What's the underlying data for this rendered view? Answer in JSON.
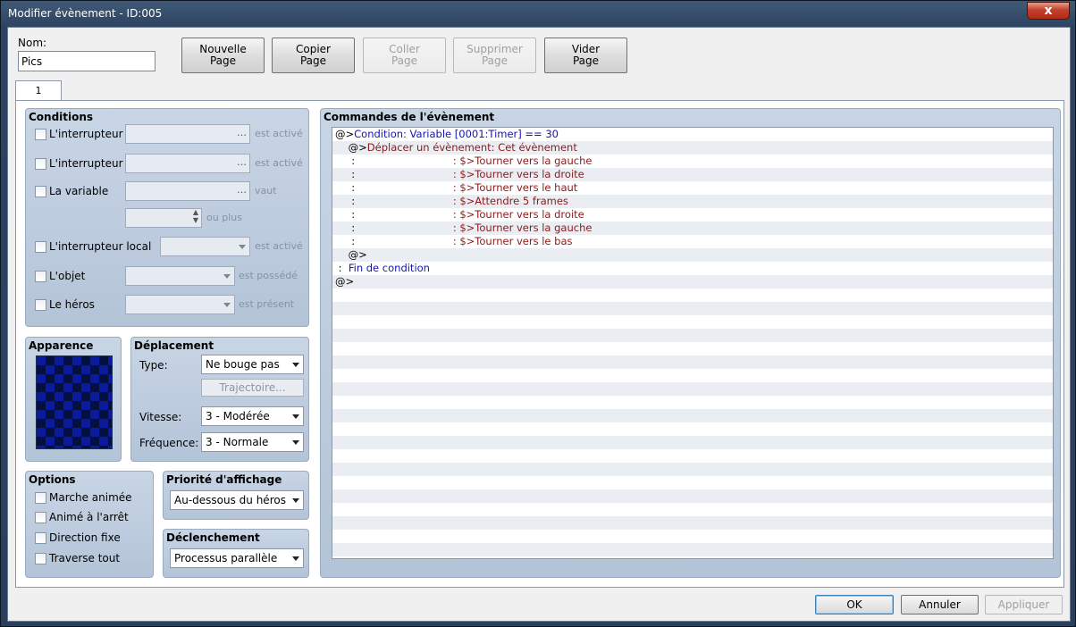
{
  "window": {
    "title": "Modifier évènement - ID:005",
    "close_glyph": "x"
  },
  "name_field": {
    "label": "Nom:",
    "value": "Pics"
  },
  "toolbar": {
    "new_page": [
      "Nouvelle",
      "Page"
    ],
    "copy_page": [
      "Copier",
      "Page"
    ],
    "paste_page": [
      "Coller",
      "Page"
    ],
    "delete_page": [
      "Supprimer",
      "Page"
    ],
    "clear_page": [
      "Vider",
      "Page"
    ]
  },
  "tabs": [
    {
      "label": "1"
    }
  ],
  "conditions": {
    "title": "Conditions",
    "switch1": {
      "label": "L'interrupteur",
      "suffix": "est activé"
    },
    "switch2": {
      "label": "L'interrupteur",
      "suffix": "est activé"
    },
    "variable": {
      "label": "La variable",
      "suffix": "vaut",
      "suffix2": "ou plus"
    },
    "self_switch": {
      "label": "L'interrupteur local",
      "suffix": "est activé"
    },
    "item": {
      "label": "L'objet",
      "suffix": "est possédé"
    },
    "actor": {
      "label": "Le héros",
      "suffix": "est présent"
    }
  },
  "appearance": {
    "title": "Apparence"
  },
  "movement": {
    "title": "Déplacement",
    "type_label": "Type:",
    "type_value": "Ne bouge pas",
    "route_button": "Trajectoire...",
    "speed_label": "Vitesse:",
    "speed_value": "3 - Modérée",
    "freq_label": "Fréquence:",
    "freq_value": "3 - Normale"
  },
  "options": {
    "title": "Options",
    "items": [
      "Marche animée",
      "Animé à l'arrêt",
      "Direction fixe",
      "Traverse tout"
    ]
  },
  "priority": {
    "title": "Priorité d'affichage",
    "value": "Au-dessous du héros"
  },
  "trigger": {
    "title": "Déclenchement",
    "value": "Processus parallèle"
  },
  "commands": {
    "title": "Commandes de l'évènement",
    "lines": [
      {
        "prefix": "@>",
        "text": "Condition: Variable [0001:Timer] == 30",
        "color": "#1515b0"
      },
      {
        "prefix": "    @>",
        "text": "Déplacer un évènement: Cet évènement",
        "color": "#8b1a1a"
      },
      {
        "prefix": "     :                              ",
        "text": ": $>Tourner vers la gauche",
        "color": "#8b1a1a"
      },
      {
        "prefix": "     :                              ",
        "text": ": $>Tourner vers la droite",
        "color": "#8b1a1a"
      },
      {
        "prefix": "     :                              ",
        "text": ": $>Tourner vers le haut",
        "color": "#8b1a1a"
      },
      {
        "prefix": "     :                              ",
        "text": ": $>Attendre 5 frames",
        "color": "#8b1a1a"
      },
      {
        "prefix": "     :                              ",
        "text": ": $>Tourner vers la droite",
        "color": "#8b1a1a"
      },
      {
        "prefix": "     :                              ",
        "text": ": $>Tourner vers la gauche",
        "color": "#8b1a1a"
      },
      {
        "prefix": "     :                              ",
        "text": ": $>Tourner vers le bas",
        "color": "#8b1a1a"
      },
      {
        "prefix": "    @>",
        "text": "",
        "color": "#000000"
      },
      {
        "prefix": " :  ",
        "text": "Fin de condition",
        "color": "#1515b0"
      },
      {
        "prefix": "@>",
        "text": "",
        "color": "#000000"
      }
    ]
  },
  "footer": {
    "ok": "OK",
    "cancel": "Annuler",
    "apply": "Appliquer"
  }
}
